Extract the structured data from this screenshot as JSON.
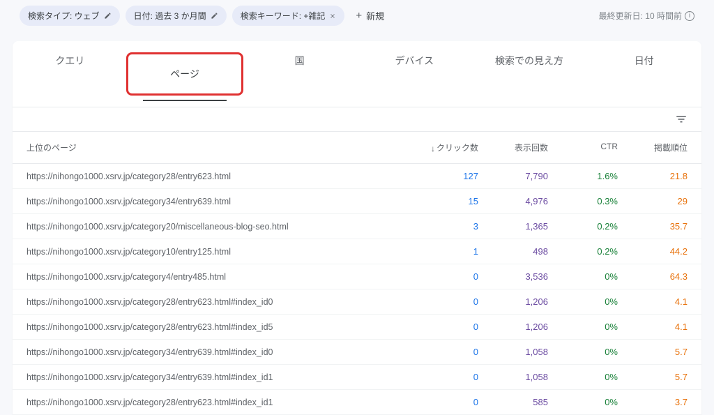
{
  "filters": {
    "chip1": "検索タイプ: ウェブ",
    "chip2": "日付: 過去 3 か月間",
    "chip3": "検索キーワード: +雑記",
    "new_label": "新規"
  },
  "meta": {
    "last_updated": "最終更新日: 10 時間前"
  },
  "tabs": {
    "query": "クエリ",
    "page": "ページ",
    "country": "国",
    "device": "デバイス",
    "appearance": "検索での見え方",
    "date": "日付"
  },
  "headers": {
    "page": "上位のページ",
    "clicks": "クリック数",
    "impressions": "表示回数",
    "ctr": "CTR",
    "position": "掲載順位"
  },
  "rows": [
    {
      "page": "https://nihongo1000.xsrv.jp/category28/entry623.html",
      "clicks": "127",
      "impressions": "7,790",
      "ctr": "1.6%",
      "position": "21.8"
    },
    {
      "page": "https://nihongo1000.xsrv.jp/category34/entry639.html",
      "clicks": "15",
      "impressions": "4,976",
      "ctr": "0.3%",
      "position": "29"
    },
    {
      "page": "https://nihongo1000.xsrv.jp/category20/miscellaneous-blog-seo.html",
      "clicks": "3",
      "impressions": "1,365",
      "ctr": "0.2%",
      "position": "35.7"
    },
    {
      "page": "https://nihongo1000.xsrv.jp/category10/entry125.html",
      "clicks": "1",
      "impressions": "498",
      "ctr": "0.2%",
      "position": "44.2"
    },
    {
      "page": "https://nihongo1000.xsrv.jp/category4/entry485.html",
      "clicks": "0",
      "impressions": "3,536",
      "ctr": "0%",
      "position": "64.3"
    },
    {
      "page": "https://nihongo1000.xsrv.jp/category28/entry623.html#index_id0",
      "clicks": "0",
      "impressions": "1,206",
      "ctr": "0%",
      "position": "4.1"
    },
    {
      "page": "https://nihongo1000.xsrv.jp/category28/entry623.html#index_id5",
      "clicks": "0",
      "impressions": "1,206",
      "ctr": "0%",
      "position": "4.1"
    },
    {
      "page": "https://nihongo1000.xsrv.jp/category34/entry639.html#index_id0",
      "clicks": "0",
      "impressions": "1,058",
      "ctr": "0%",
      "position": "5.7"
    },
    {
      "page": "https://nihongo1000.xsrv.jp/category34/entry639.html#index_id1",
      "clicks": "0",
      "impressions": "1,058",
      "ctr": "0%",
      "position": "5.7"
    },
    {
      "page": "https://nihongo1000.xsrv.jp/category28/entry623.html#index_id1",
      "clicks": "0",
      "impressions": "585",
      "ctr": "0%",
      "position": "3.7"
    }
  ]
}
